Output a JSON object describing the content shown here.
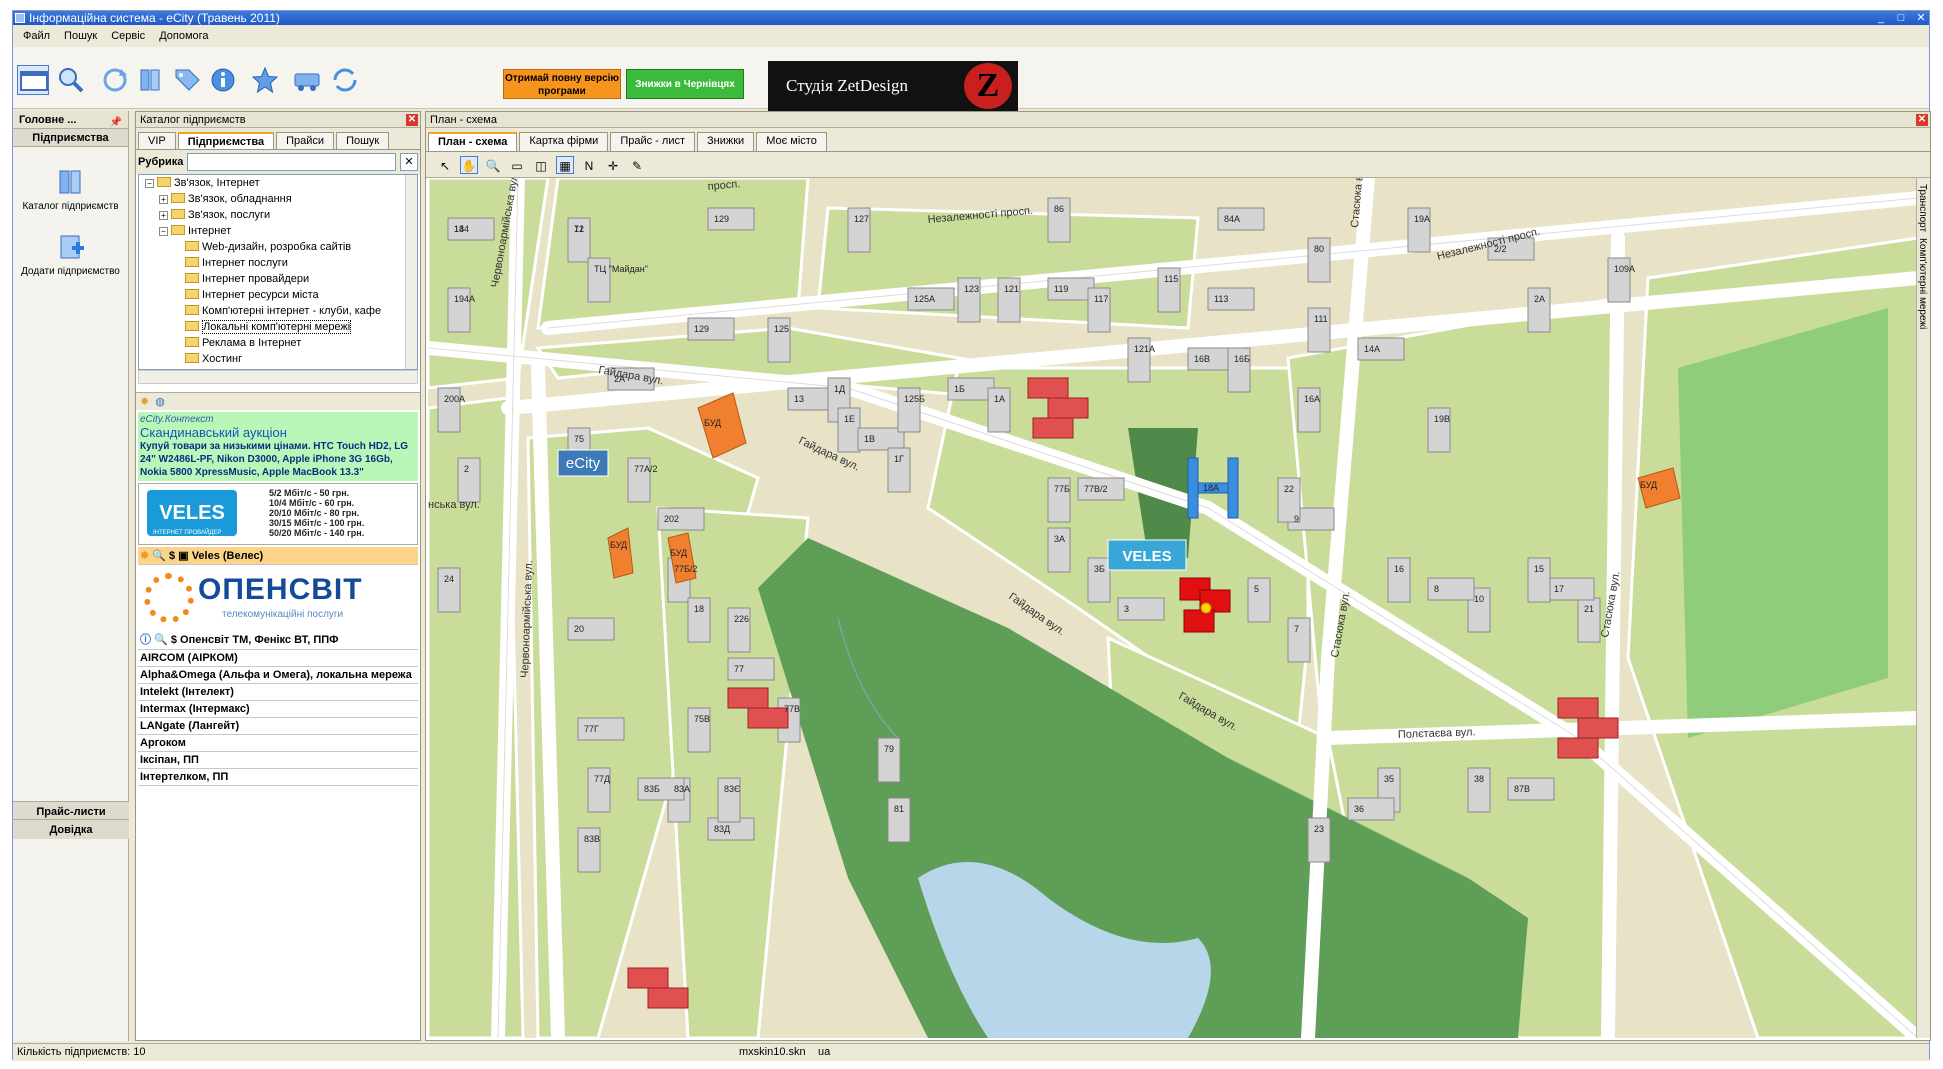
{
  "window": {
    "title": "Інформаційна система - eCity (Травень 2011)"
  },
  "menu": [
    "Файл",
    "Пошук",
    "Сервіс",
    "Допомога"
  ],
  "banners": {
    "b1": "Отримай повну версію програми",
    "b2": "Знижки в Чернівцях",
    "b3": "Студія ZetDesign",
    "b3_letter": "Z"
  },
  "leftnav": {
    "header": "Головне ...",
    "section": "Підприємства",
    "items": [
      "Каталог підприємств",
      "Додати підприємство"
    ],
    "bottom": [
      "Прайс-листи",
      "Довідка"
    ]
  },
  "catalog": {
    "title": "Каталог підприємств",
    "tabs": [
      "VIP",
      "Підприємства",
      "Прайси",
      "Пошук"
    ],
    "rubric_label": "Рубрика",
    "tree": [
      {
        "label": "Зв'язок, Інтернет",
        "level": 0,
        "exp": "−"
      },
      {
        "label": "Зв'язок, обладнання",
        "level": 1,
        "exp": "+"
      },
      {
        "label": "Зв'язок, послуги",
        "level": 1,
        "exp": "+"
      },
      {
        "label": "Інтернет",
        "level": 1,
        "exp": "−"
      },
      {
        "label": "Web-дизайн, розробка сайтів",
        "level": 2
      },
      {
        "label": "Інтернет послуги",
        "level": 2
      },
      {
        "label": "Інтернет провайдери",
        "level": 2
      },
      {
        "label": "Інтернет ресурси міста",
        "level": 2
      },
      {
        "label": "Комп'ютерні інтернет - клуби, кафе",
        "level": 2
      },
      {
        "label": "Локальні комп'ютерні мережі",
        "level": 2,
        "selected": true
      },
      {
        "label": "Реклама в Інтернет",
        "level": 2
      },
      {
        "label": "Хостинг",
        "level": 2
      }
    ],
    "context": {
      "label": "eCity.Контекст",
      "title": "Скандинавський аукціон",
      "text": "Купуй товари за низькими цінами. HTC Touch HD2, LG 24\" W2486L-PF, Nikon D3000, Apple iPhone 3G 16Gb, Nokia 5800 XpressMusic, Apple MacBook 13.3\""
    },
    "veles_ad": {
      "logo": "VELES",
      "logo_sub": "ІНТЕРНЕТ ПРОВАЙДЕР",
      "prices": [
        "5/2 Мбіт/с - 50 грн.",
        "10/4 Мбіт/с - 60 грн.",
        "20/10 Мбіт/с - 80 грн.",
        "30/15 Мбіт/с - 100 грн.",
        "50/20 Мбіт/с - 140 грн."
      ]
    },
    "company1": "Veles (Велес)",
    "opensvit": {
      "name": "ОПЕНСВІТ",
      "sub": "телекомунікаційні послуги"
    },
    "company2": "Опенсвіт ТМ, Фенікс ВТ, ППФ",
    "companies": [
      "AIRCOM (АІРКОМ)",
      "Alpha&Omega (Альфа и Омега), локальна мережа",
      "Intelekt (Інтелект)",
      "Intermax (Інтермакс)",
      "LANgate (Лангейт)",
      "Аргоком",
      "Іксіпан, ПП",
      "Інтертелком, ПП"
    ]
  },
  "mappanel": {
    "title": "План - схема",
    "tabs": [
      "План - схема",
      "Картка фірми",
      "Прайс - лист",
      "Знижки",
      "Моє місто"
    ],
    "tools": [
      "↖",
      "✋",
      "🔍",
      "▭",
      "◫",
      "▦",
      "N",
      "✛",
      "✎"
    ],
    "right_strip": [
      "Транспорт",
      "Комп'ютерні мережі"
    ],
    "streets": [
      "просп.",
      "Незалежності просп.",
      "Незалежності просп.",
      "Червоноармійська вул.",
      "Червоноармійська вул.",
      "Гайдара вул.",
      "Гайдара вул.",
      "Гайдара вул.",
      "Гайдара вул.",
      "Стасюка вул.",
      "Стасюка вул.",
      "Стасюка вул.",
      "Полєтаєва вул.",
      "нська вул."
    ],
    "labels": {
      "ecity": "eCity",
      "veles": "VELES",
      "bud": "БУД",
      "b18a": "18А"
    },
    "buildings": [
      "184",
      "71",
      "ТЦ \"Майдан\"",
      "129",
      "127",
      "86",
      "84А",
      "80",
      "115",
      "113",
      "111",
      "19А",
      "2/2",
      "109А",
      "2А",
      "125А",
      "123",
      "121",
      "119",
      "117",
      "194А",
      "129",
      "125",
      "200А",
      "2А",
      "75",
      "77А/2",
      "13",
      "1Д",
      "1Е",
      "1В",
      "1Г",
      "125Б",
      "1Б",
      "1А",
      "121А",
      "16В",
      "16Б",
      "16А",
      "14А",
      "19В",
      "2",
      "202",
      "77Б/2",
      "77Б",
      "77В/2",
      "3А",
      "3Б",
      "3",
      "5",
      "7",
      "9",
      "22",
      "24",
      "20",
      "18",
      "226",
      "77",
      "77В",
      "75В",
      "77Г",
      "77Д",
      "83А",
      "83Д",
      "83Є",
      "83В",
      "83Б",
      "79",
      "81",
      "87В",
      "38",
      "35",
      "36",
      "23",
      "21",
      "17",
      "15",
      "10",
      "8",
      "16",
      "14",
      "12"
    ],
    "footnote": "13"
  },
  "status": {
    "count": "Кількість підприємств: 10",
    "skin": "mxskin10.skn",
    "lang": "ua"
  },
  "colors": {
    "map_bg": "#e8e2c6",
    "block": "#c9dc9a",
    "park": "#5f9e56",
    "water": "#b8d6ea",
    "street": "#ffffff",
    "building": "#d8d8d8"
  }
}
